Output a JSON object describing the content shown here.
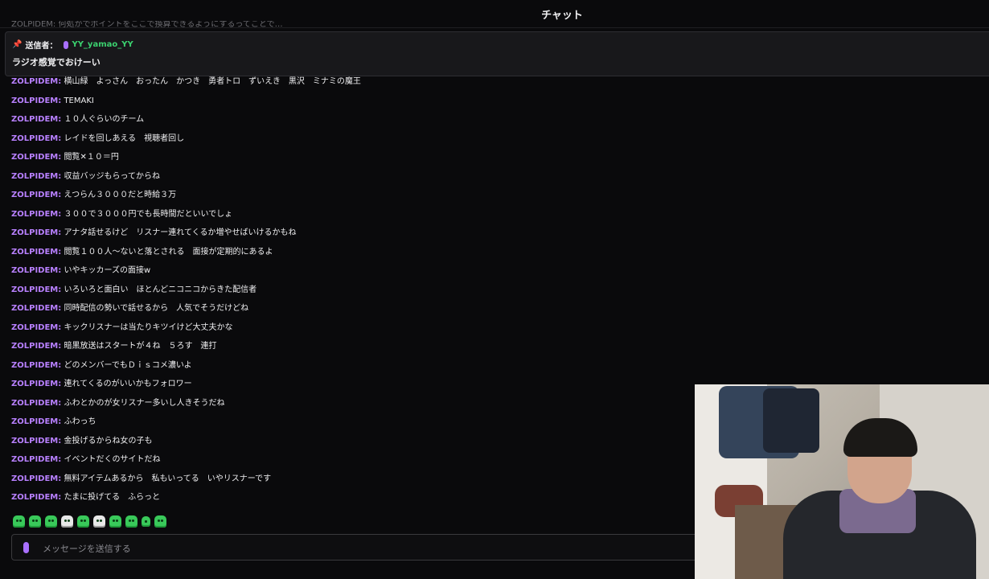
{
  "header": {
    "title": "チャット"
  },
  "ghost_line": "ZOLPIDEM: 何処かでポイントをここで換算できるようにするってことで…",
  "pinned": {
    "label": "送信者：",
    "user": "YY_yamao_YY",
    "message": "ラジオ感覚でおけーい"
  },
  "messages": [
    {
      "user": "ZOLPIDEM:",
      "text": "横山緑　よっさん　おったん　かつき　勇者トロ　ずいえき　黒沢　ミナミの魔王"
    },
    {
      "user": "ZOLPIDEM:",
      "text": "TEMAKI"
    },
    {
      "user": "ZOLPIDEM:",
      "text": "１０人ぐらいのチーム"
    },
    {
      "user": "ZOLPIDEM:",
      "text": "レイドを回しあえる　視聴者回し"
    },
    {
      "user": "ZOLPIDEM:",
      "text": "閲覧✕１０＝円"
    },
    {
      "user": "ZOLPIDEM:",
      "text": "収益バッジもらってからね"
    },
    {
      "user": "ZOLPIDEM:",
      "text": "えつらん３０００だと時給３万"
    },
    {
      "user": "ZOLPIDEM:",
      "text": "３００で３０００円でも長時間だといいでしょ"
    },
    {
      "user": "ZOLPIDEM:",
      "text": "アナタ話せるけど　リスナー連れてくるか増やせばいけるかもね"
    },
    {
      "user": "ZOLPIDEM:",
      "text": "閲覧１００人〜ないと落とされる　面接が定期的にあるよ"
    },
    {
      "user": "ZOLPIDEM:",
      "text": "いやキッカーズの面接w"
    },
    {
      "user": "ZOLPIDEM:",
      "text": "いろいろと面白い　ほとんどニコニコからきた配信者"
    },
    {
      "user": "ZOLPIDEM:",
      "text": "同時配信の勢いで話せるから　人気でそうだけどね"
    },
    {
      "user": "ZOLPIDEM:",
      "text": "キックリスナーは当たりキツイけど大丈夫かな"
    },
    {
      "user": "ZOLPIDEM:",
      "text": "暗黒放送はスタートが４ね　５ろす　連打"
    },
    {
      "user": "ZOLPIDEM:",
      "text": "どのメンバーでもＤｉｓコメ濃いよ"
    },
    {
      "user": "ZOLPIDEM:",
      "text": "連れてくるのがいいかもフォロワー"
    },
    {
      "user": "ZOLPIDEM:",
      "text": "ふわとかのが女リスナー多いし人きそうだね"
    },
    {
      "user": "ZOLPIDEM:",
      "text": "ふわっち"
    },
    {
      "user": "ZOLPIDEM:",
      "text": "金投げるからね女の子も"
    },
    {
      "user": "ZOLPIDEM:",
      "text": "イベントだくのサイトだね"
    },
    {
      "user": "ZOLPIDEM:",
      "text": "無料アイテムあるから　私もいってる　いやリスナーです"
    },
    {
      "user": "ZOLPIDEM:",
      "text": "たまに投げてる　ふらっと"
    }
  ],
  "emotes": [
    "green-blob-emote",
    "green-ghost-emote",
    "green-box-emote",
    "white-face-emote",
    "green-wave-emote",
    "white-cross-emote",
    "green-smile-emote",
    "green-blob-emote",
    "green-small-emote",
    "green-face-emote"
  ],
  "input": {
    "placeholder": "メッセージを送信する"
  },
  "colors": {
    "username": "#b880ff",
    "pinned_user": "#3bd16f",
    "background": "#0a0a0c",
    "emote": "#39c95a"
  }
}
